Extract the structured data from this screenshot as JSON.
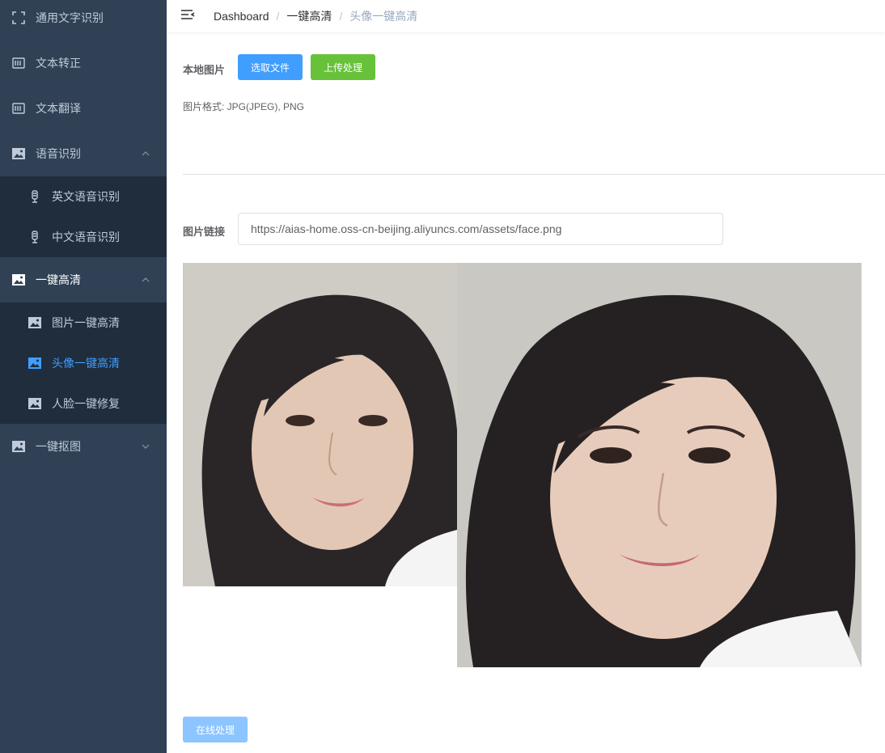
{
  "sidebar": {
    "items": [
      {
        "label": "通用文字识别",
        "icon": "scan-icon"
      },
      {
        "label": "文本转正",
        "icon": "document-icon"
      },
      {
        "label": "文本翻译",
        "icon": "document-icon"
      },
      {
        "label": "语音识别",
        "icon": "image-icon",
        "expanded": true
      },
      {
        "label": "英文语音识别",
        "icon": "microphone-icon"
      },
      {
        "label": "中文语音识别",
        "icon": "microphone-icon"
      },
      {
        "label": "一键高清",
        "icon": "image-icon",
        "expanded": true
      },
      {
        "label": "图片一键高清",
        "icon": "image-icon"
      },
      {
        "label": "头像一键高清",
        "icon": "image-icon",
        "active": true
      },
      {
        "label": "人脸一键修复",
        "icon": "image-icon"
      },
      {
        "label": "一键抠图",
        "icon": "image-icon",
        "expanded": false
      }
    ]
  },
  "breadcrumb": {
    "items": [
      "Dashboard",
      "一键高清",
      "头像一键高清"
    ]
  },
  "upload": {
    "label": "本地图片",
    "select_button": "选取文件",
    "upload_button": "上传处理",
    "format_hint": "图片格式: JPG(JPEG), PNG"
  },
  "link": {
    "label": "图片链接",
    "value": "https://aias-home.oss-cn-beijing.aliyuncs.com/assets/face.png"
  },
  "actions": {
    "process_button": "在线处理"
  },
  "colors": {
    "sidebar_bg": "#304156",
    "submenu_bg": "#1f2d3d",
    "active": "#409eff",
    "success": "#67c23a"
  }
}
